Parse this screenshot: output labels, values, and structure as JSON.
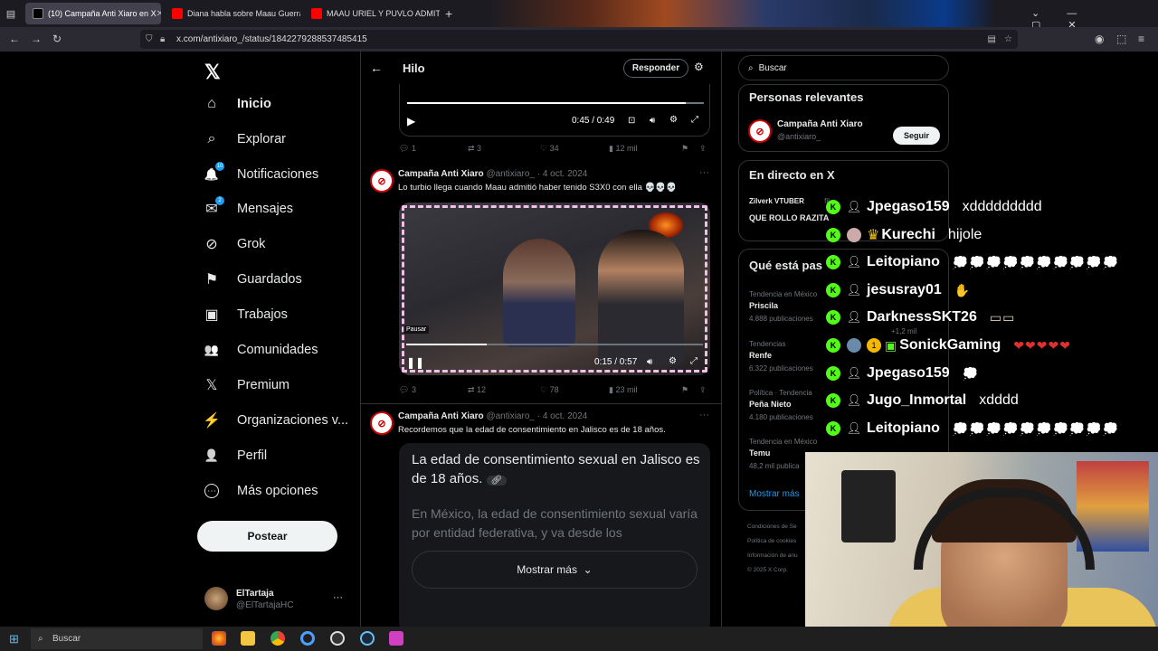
{
  "browser": {
    "tabs": [
      {
        "label": "(10) Campaña Anti Xiaro en X"
      },
      {
        "label": "Diana habla sobre Maau Guerra"
      },
      {
        "label": "MAAU URIEL Y PUVLO ADMITEN"
      }
    ],
    "new_tab": "+",
    "url": "x.com/antixiaro_/status/1842279288537485415"
  },
  "left_nav": {
    "logo": "𝕏",
    "items": [
      {
        "label": "Inicio",
        "icon": "⌂"
      },
      {
        "label": "Explorar",
        "icon": "⌕"
      },
      {
        "label": "Notificaciones",
        "icon": "🔔",
        "badge": "10"
      },
      {
        "label": "Mensajes",
        "icon": "✉",
        "badge": "2"
      },
      {
        "label": "Grok",
        "icon": "⊘"
      },
      {
        "label": "Guardados",
        "icon": "⚑"
      },
      {
        "label": "Trabajos",
        "icon": "▣"
      },
      {
        "label": "Comunidades",
        "icon": "👥"
      },
      {
        "label": "Premium",
        "icon": "𝕏"
      },
      {
        "label": "Organizaciones v...",
        "icon": "⚡"
      },
      {
        "label": "Perfil",
        "icon": "👤"
      },
      {
        "label": "Más opciones",
        "icon": "⋯"
      }
    ],
    "post_button": "Postear",
    "profile": {
      "name": "ElTartaja",
      "handle": "@ElTartajaHC",
      "more": "···"
    }
  },
  "thread": {
    "back": "←",
    "title": "Hilo",
    "reply_button": "Responder",
    "top_video": {
      "time": "0:45 / 0:49",
      "progress": 0.94
    },
    "top_actions": {
      "replies": "1",
      "reposts": "3",
      "likes": "34",
      "views": "12 mil"
    },
    "tweet1": {
      "name": "Campaña Anti Xiaro",
      "handle": "@antixiaro_",
      "date": "· 4 oct. 2024",
      "text": "Lo turbio llega cuando Maau admitió haber tenido S3X0 con ella 💀💀💀",
      "video": {
        "time": "0:15 / 0:57",
        "progress": 0.27,
        "pause_tooltip": "Pausar"
      },
      "actions": {
        "replies": "3",
        "reposts": "12",
        "likes": "78",
        "views": "23 mil"
      }
    },
    "tweet2": {
      "name": "Campaña Anti Xiaro",
      "handle": "@antixiaro_",
      "date": "· 4 oct. 2024",
      "text": "Recordemos que la edad de consentimiento en Jalisco es de 18 años.",
      "card_title": "La edad de consentimiento sexual en Jalisco es de 18 años.",
      "card_body": "En México, la edad de consentimiento sexual varía por entidad federativa, y va desde los",
      "show_more": "Mostrar más"
    }
  },
  "right_col": {
    "search_placeholder": "Buscar",
    "relevant": {
      "title": "Personas relevantes",
      "name": "Campaña Anti Xiaro",
      "handle": "@antixiaro_",
      "follow": "Seguir"
    },
    "live": {
      "title": "En directo en X",
      "host": "Zilverk VTUBER",
      "host_suffix": "fil...",
      "title_line": "QUE ROLLO RAZITA",
      "viewers": "+1,2 mil"
    },
    "trends": {
      "title": "Qué está pas",
      "items": [
        {
          "context": "Tendencia en México",
          "name": "Priscila",
          "count": "4.888 publicaciones"
        },
        {
          "context": "Tendencias",
          "name": "Renfe",
          "count": "6.322 publicaciones"
        },
        {
          "context": "Política · Tendencia",
          "name": "Peña Nieto",
          "count": "4.180 publicaciones"
        },
        {
          "context": "Tendencia en México",
          "name": "Temu",
          "count": "48,2 mil publica"
        }
      ],
      "show_more": "Mostrar más"
    },
    "footer": [
      "Condiciones de Se",
      "Política de cookies",
      "Información de anu",
      "© 2025 X Corp."
    ]
  },
  "chat": [
    {
      "user": "Jpegaso159",
      "msg": "xddddddddd",
      "kind": "text"
    },
    {
      "user": "Kurechi",
      "msg": "hijole",
      "kind": "text",
      "crown": "♛"
    },
    {
      "user": "Leitopiano",
      "msg": "💭💭💭💭💭💭💭💭💭💭",
      "kind": "emote"
    },
    {
      "user": "jesusray01",
      "msg": "✋",
      "kind": "emote"
    },
    {
      "user": "DarknessSKT26",
      "msg": "▭▭",
      "kind": "emote"
    },
    {
      "user": "SonickGaming",
      "msg": "❤❤❤❤❤",
      "kind": "emote",
      "level": "1"
    },
    {
      "user": "Jpegaso159",
      "msg": "💭",
      "kind": "emote"
    },
    {
      "user": "Jugo_Inmortal",
      "msg": "xdddd",
      "kind": "text"
    },
    {
      "user": "Leitopiano",
      "msg": "💭💭💭💭💭💭💭💭💭💭",
      "kind": "emote"
    }
  ],
  "taskbar": {
    "search": "Buscar"
  },
  "colors": {
    "accent": "#1d9bf0",
    "kick_green": "#53fc18",
    "bg": "#000000",
    "muted": "#71767b"
  }
}
